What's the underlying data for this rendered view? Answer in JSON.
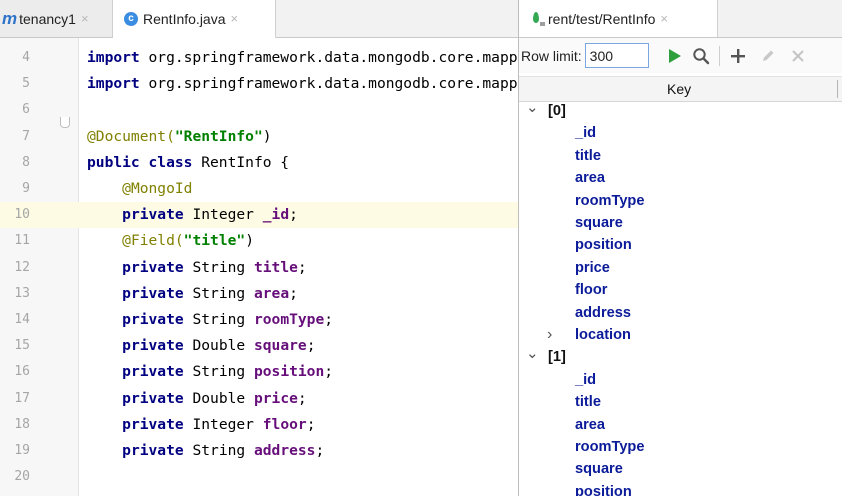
{
  "editor": {
    "tabs": [
      {
        "icon": "module-icon",
        "label": "tenancy1",
        "close": "×"
      },
      {
        "icon": "class-icon",
        "badge": "c",
        "label": "RentInfo.java",
        "close": "×"
      }
    ],
    "current_line": 10,
    "lines": [
      {
        "num": "4",
        "tokens": [
          {
            "t": "import",
            "c": "kw"
          },
          {
            "t": " org.springframework.data.mongodb.core.mapping.Document;",
            "c": "plain"
          }
        ]
      },
      {
        "num": "5",
        "tokens": [
          {
            "t": "import",
            "c": "kw"
          },
          {
            "t": " org.springframework.data.mongodb.core.mapping.Field;",
            "c": "plain"
          }
        ]
      },
      {
        "num": "6",
        "tokens": []
      },
      {
        "num": "7",
        "tokens": [
          {
            "t": "@Document(",
            "c": "ann"
          },
          {
            "t": "\"RentInfo\"",
            "c": "str"
          },
          {
            "t": ")",
            "c": "plain"
          }
        ]
      },
      {
        "num": "8",
        "tokens": [
          {
            "t": "public class",
            "c": "kw"
          },
          {
            "t": " RentInfo {",
            "c": "plain"
          }
        ]
      },
      {
        "num": "9",
        "tokens": [
          {
            "t": "    ",
            "c": "plain"
          },
          {
            "t": "@MongoId",
            "c": "ann"
          }
        ]
      },
      {
        "num": "10",
        "tokens": [
          {
            "t": "    ",
            "c": "plain"
          },
          {
            "t": "private",
            "c": "kw"
          },
          {
            "t": " Integer ",
            "c": "plain"
          },
          {
            "t": "_id",
            "c": "fld"
          },
          {
            "t": ";",
            "c": "plain"
          }
        ]
      },
      {
        "num": "11",
        "tokens": [
          {
            "t": "    ",
            "c": "plain"
          },
          {
            "t": "@Field(",
            "c": "ann"
          },
          {
            "t": "\"title\"",
            "c": "str"
          },
          {
            "t": ")",
            "c": "plain"
          }
        ]
      },
      {
        "num": "12",
        "tokens": [
          {
            "t": "    ",
            "c": "plain"
          },
          {
            "t": "private",
            "c": "kw"
          },
          {
            "t": " String ",
            "c": "plain"
          },
          {
            "t": "title",
            "c": "fld"
          },
          {
            "t": ";",
            "c": "plain"
          }
        ]
      },
      {
        "num": "13",
        "tokens": [
          {
            "t": "    ",
            "c": "plain"
          },
          {
            "t": "private",
            "c": "kw"
          },
          {
            "t": " String ",
            "c": "plain"
          },
          {
            "t": "area",
            "c": "fld"
          },
          {
            "t": ";",
            "c": "plain"
          }
        ]
      },
      {
        "num": "14",
        "tokens": [
          {
            "t": "    ",
            "c": "plain"
          },
          {
            "t": "private",
            "c": "kw"
          },
          {
            "t": " String ",
            "c": "plain"
          },
          {
            "t": "roomType",
            "c": "fld"
          },
          {
            "t": ";",
            "c": "plain"
          }
        ]
      },
      {
        "num": "15",
        "tokens": [
          {
            "t": "    ",
            "c": "plain"
          },
          {
            "t": "private",
            "c": "kw"
          },
          {
            "t": " Double ",
            "c": "plain"
          },
          {
            "t": "square",
            "c": "fld"
          },
          {
            "t": ";",
            "c": "plain"
          }
        ]
      },
      {
        "num": "16",
        "tokens": [
          {
            "t": "    ",
            "c": "plain"
          },
          {
            "t": "private",
            "c": "kw"
          },
          {
            "t": " String ",
            "c": "plain"
          },
          {
            "t": "position",
            "c": "fld"
          },
          {
            "t": ";",
            "c": "plain"
          }
        ]
      },
      {
        "num": "17",
        "tokens": [
          {
            "t": "    ",
            "c": "plain"
          },
          {
            "t": "private",
            "c": "kw"
          },
          {
            "t": " Double ",
            "c": "plain"
          },
          {
            "t": "price",
            "c": "fld"
          },
          {
            "t": ";",
            "c": "plain"
          }
        ]
      },
      {
        "num": "18",
        "tokens": [
          {
            "t": "    ",
            "c": "plain"
          },
          {
            "t": "private",
            "c": "kw"
          },
          {
            "t": " Integer ",
            "c": "plain"
          },
          {
            "t": "floor",
            "c": "fld"
          },
          {
            "t": ";",
            "c": "plain"
          }
        ]
      },
      {
        "num": "19",
        "tokens": [
          {
            "t": "    ",
            "c": "plain"
          },
          {
            "t": "private",
            "c": "kw"
          },
          {
            "t": " String ",
            "c": "plain"
          },
          {
            "t": "address",
            "c": "fld"
          },
          {
            "t": ";",
            "c": "plain"
          }
        ]
      },
      {
        "num": "20",
        "tokens": []
      }
    ]
  },
  "db": {
    "tab": {
      "icon": "mongodb-leaf-icon",
      "label": "rent/test/RentInfo",
      "close": "×"
    },
    "toolbar": {
      "row_limit_label": "Row limit:",
      "row_limit_value": "300",
      "buttons": [
        "run-icon",
        "search-icon",
        "add-icon",
        "edit-icon",
        "delete-icon"
      ]
    },
    "header": {
      "key": "Key"
    },
    "tree": [
      {
        "label": "[0]",
        "kind": "doc",
        "expanded": true
      },
      {
        "label": "_id",
        "kind": "field"
      },
      {
        "label": "title",
        "kind": "field"
      },
      {
        "label": "area",
        "kind": "field"
      },
      {
        "label": "roomType",
        "kind": "field"
      },
      {
        "label": "square",
        "kind": "field"
      },
      {
        "label": "position",
        "kind": "field"
      },
      {
        "label": "price",
        "kind": "field"
      },
      {
        "label": "floor",
        "kind": "field"
      },
      {
        "label": "address",
        "kind": "field"
      },
      {
        "label": "location",
        "kind": "field",
        "collapsed": true
      },
      {
        "label": "[1]",
        "kind": "doc",
        "expanded": true
      },
      {
        "label": "_id",
        "kind": "field"
      },
      {
        "label": "title",
        "kind": "field"
      },
      {
        "label": "area",
        "kind": "field"
      },
      {
        "label": "roomType",
        "kind": "field"
      },
      {
        "label": "square",
        "kind": "field"
      },
      {
        "label": "position",
        "kind": "field"
      }
    ]
  },
  "colors": {
    "keyword": "#000080",
    "annotation": "#808000",
    "string": "#008000",
    "field": "#660e7a",
    "tree_field": "#0b1b99",
    "current_line": "#fdfbe3",
    "run": "#2e9f3c"
  }
}
